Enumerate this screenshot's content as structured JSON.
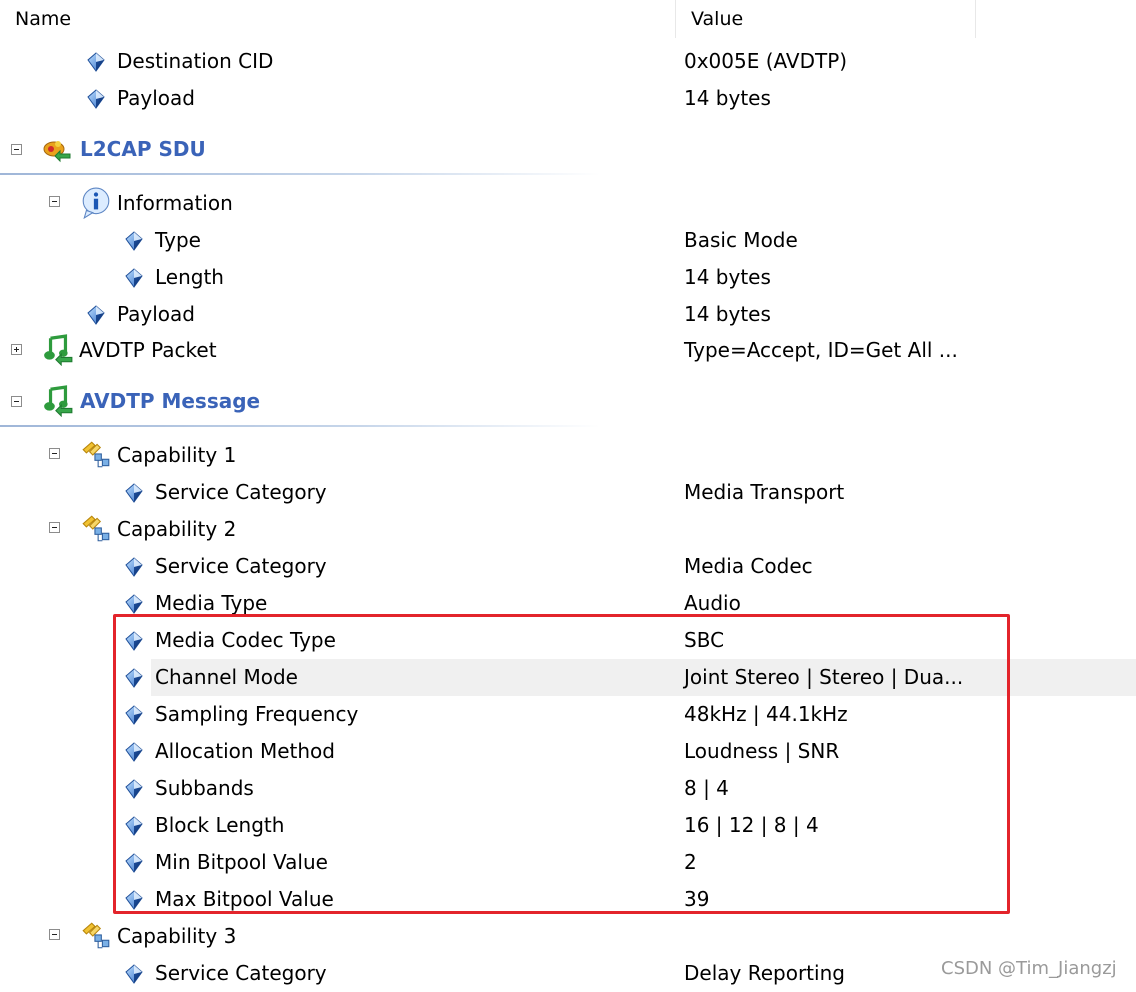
{
  "header": {
    "name": "Name",
    "value": "Value"
  },
  "rows": [
    {
      "label": "Destination CID",
      "value": "0x005E (AVDTP)"
    },
    {
      "label": "Payload",
      "value": "14 bytes"
    },
    {
      "label": "L2CAP SDU",
      "value": ""
    },
    {
      "label": "Information",
      "value": ""
    },
    {
      "label": "Type",
      "value": "Basic Mode"
    },
    {
      "label": "Length",
      "value": "14 bytes"
    },
    {
      "label": "Payload",
      "value": "14 bytes"
    },
    {
      "label": "AVDTP Packet",
      "value": "Type=Accept, ID=Get All ..."
    },
    {
      "label": "AVDTP Message",
      "value": ""
    },
    {
      "label": "Capability 1",
      "value": ""
    },
    {
      "label": "Service Category",
      "value": "Media Transport"
    },
    {
      "label": "Capability 2",
      "value": ""
    },
    {
      "label": "Service Category",
      "value": "Media Codec"
    },
    {
      "label": "Media Type",
      "value": "Audio"
    },
    {
      "label": "Media Codec Type",
      "value": "SBC"
    },
    {
      "label": "Channel Mode",
      "value": "Joint Stereo | Stereo | Dua..."
    },
    {
      "label": "Sampling Frequency",
      "value": "48kHz | 44.1kHz"
    },
    {
      "label": "Allocation Method",
      "value": "Loudness | SNR"
    },
    {
      "label": "Subbands",
      "value": "8 | 4"
    },
    {
      "label": "Block Length",
      "value": "16 | 12 | 8 | 4"
    },
    {
      "label": "Min Bitpool Value",
      "value": "2"
    },
    {
      "label": "Max Bitpool Value",
      "value": "39"
    },
    {
      "label": "Capability 3",
      "value": ""
    },
    {
      "label": "Service Category",
      "value": "Delay Reporting"
    }
  ],
  "watermark": "CSDN @Tim_Jiangzj",
  "colors": {
    "group_text": "#3a63b8",
    "highlight_border": "#e3242b",
    "selected_row": "#f0f0f0"
  }
}
